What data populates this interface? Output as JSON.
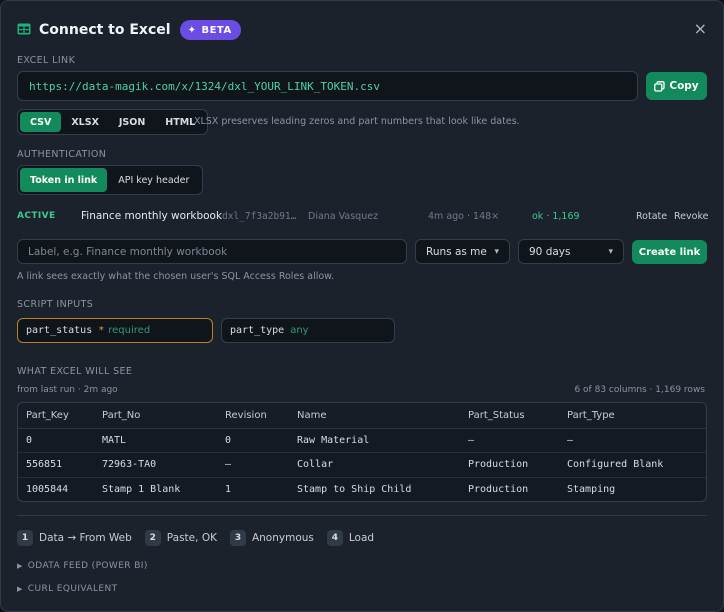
{
  "header": {
    "title": "Connect to Excel",
    "beta": "BETA",
    "close": "×"
  },
  "excel_link": {
    "label": "EXCEL LINK",
    "url": "https://data-magik.com/x/1324/dxl_YOUR_LINK_TOKEN.csv",
    "copy_label": "Copy"
  },
  "format": {
    "options": [
      "CSV",
      "XLSX",
      "JSON",
      "HTML"
    ],
    "selected": "CSV",
    "hint": "XLSX preserves leading zeros and part numbers that look like dates."
  },
  "authentication": {
    "label": "AUTHENTICATION",
    "options": [
      "Token in link",
      "API key header"
    ],
    "selected": "Token in link"
  },
  "token": {
    "status": "ACTIVE",
    "name": "Finance monthly workbook",
    "token_prefix": "dxl_7f3a2b91…",
    "owner": "Diana Vasquez",
    "usage": "4m ago · 148×",
    "last_result": "ok · 1,169",
    "rotate": "Rotate",
    "revoke": "Revoke"
  },
  "create": {
    "label_placeholder": "Label, e.g. Finance monthly workbook",
    "runs_as": "Runs as me",
    "expiry": "90 days",
    "button": "Create link",
    "hint": "A link sees exactly what the chosen user's SQL Access Roles allow."
  },
  "script_inputs": {
    "label": "SCRIPT INPUTS",
    "params": [
      {
        "name": "part_status",
        "star": "*",
        "value": "required"
      },
      {
        "name": "part_type",
        "value": "any"
      }
    ]
  },
  "preview": {
    "label": "WHAT EXCEL WILL SEE",
    "subtitle": "from last run · 2m ago",
    "summary": "6 of 83 columns · 1,169 rows",
    "columns": [
      "Part_Key",
      "Part_No",
      "Revision",
      "Name",
      "Part_Status",
      "Part_Type"
    ],
    "rows": [
      [
        "0",
        "MATL",
        "0",
        "Raw Material",
        "—",
        "—"
      ],
      [
        "556851",
        "72963-TA0",
        "—",
        "Collar",
        "Production",
        "Configured Blank"
      ],
      [
        "1005844",
        "Stamp 1 Blank",
        "1",
        "Stamp to Ship Child",
        "Production",
        "Stamping"
      ]
    ]
  },
  "steps": [
    {
      "num": "1",
      "label": "Data → From Web"
    },
    {
      "num": "2",
      "label": "Paste, OK"
    },
    {
      "num": "3",
      "label": "Anonymous"
    },
    {
      "num": "4",
      "label": "Load"
    }
  ],
  "collapsibles": {
    "odata": "ODATA FEED (POWER BI)",
    "curl": "CURL EQUIVALENT"
  },
  "colors": {
    "accent": "#128a5c",
    "beta": "#6b4de6",
    "warning_border": "#b8822a",
    "link_text": "#4dd2a0"
  }
}
